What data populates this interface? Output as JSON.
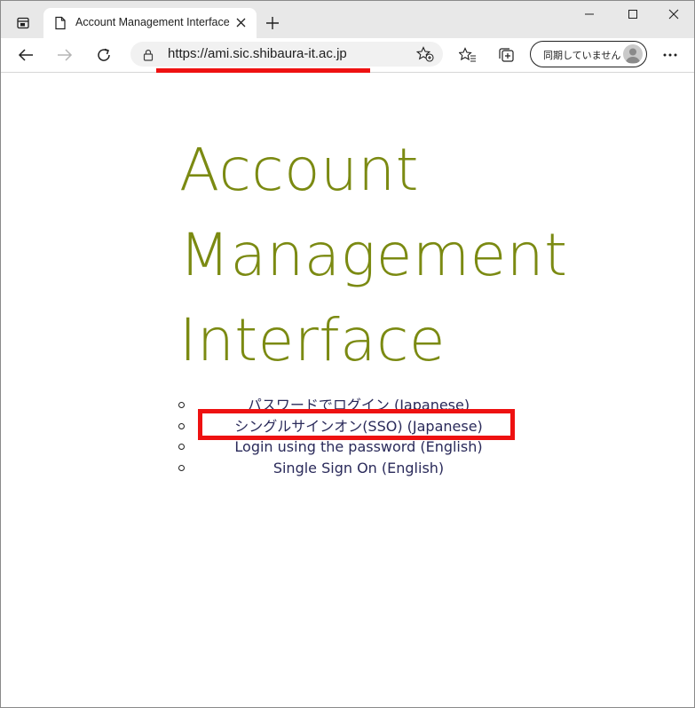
{
  "browser": {
    "tab": {
      "title": "Account Management Interface"
    },
    "address_bar": {
      "url": "https://ami.sic.shibaura-it.ac.jp"
    },
    "profile": {
      "label": "同期していません"
    },
    "icons": {
      "tab_actions": "tab-actions-icon",
      "tab_page": "document-icon",
      "tab_close": "close-icon",
      "new_tab": "plus-icon",
      "minimize": "minimize-icon",
      "maximize": "maximize-icon",
      "close_window": "close-icon",
      "back": "back-arrow-icon",
      "forward": "forward-arrow-icon",
      "refresh": "refresh-icon",
      "lock": "lock-icon",
      "add_favorite": "star-plus-icon",
      "favorites": "favorites-icon",
      "collections": "collections-icon",
      "avatar": "avatar-icon",
      "more": "more-icon"
    }
  },
  "page": {
    "heading_lines": [
      "Account",
      "Management",
      "Interface"
    ],
    "links": [
      "パスワードでログイン (Japanese)",
      "シングルサインオン(SSO) (Japanese)",
      "Login using the password (English)",
      "Single Sign On (English)"
    ]
  },
  "annotations": {
    "highlight_color": "#ee1111",
    "heading_color": "#7b8a12",
    "link_color": "#2a2a5a"
  }
}
